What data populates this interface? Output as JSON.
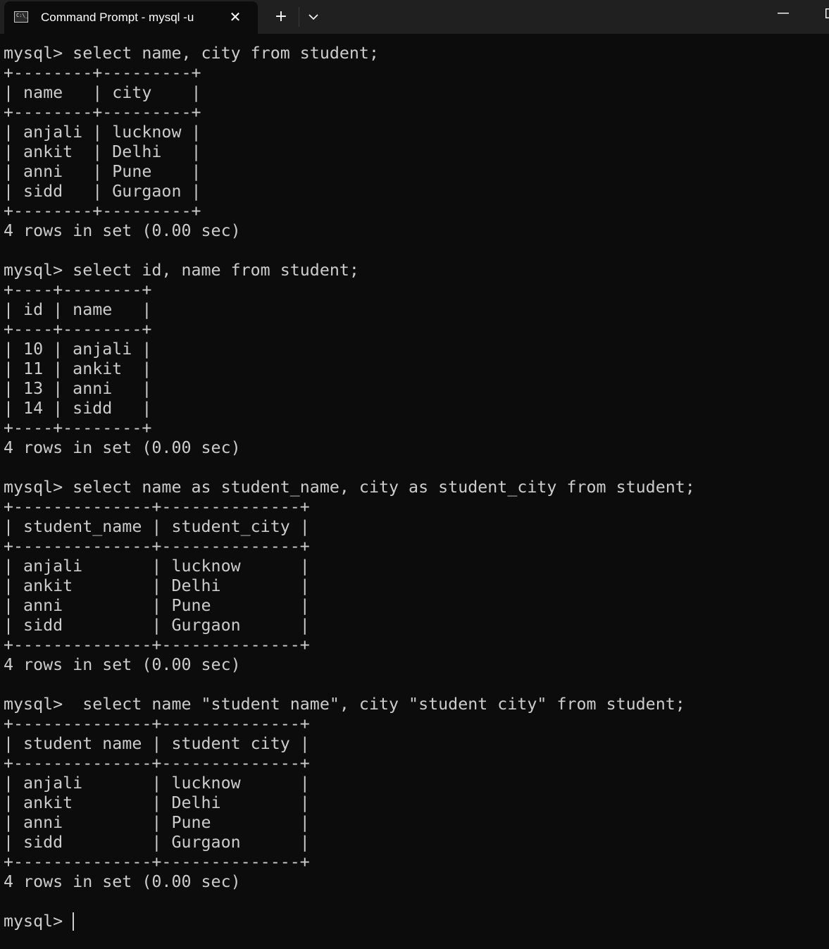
{
  "window": {
    "tab_title": "Command Prompt - mysql  -u",
    "tab_icon_prompt": "C:\\_",
    "close_glyph": "✕",
    "new_tab_glyph": "+"
  },
  "terminal": {
    "lines": [
      "mysql> select name, city from student;",
      "+--------+---------+",
      "| name   | city    |",
      "+--------+---------+",
      "| anjali | lucknow |",
      "| ankit  | Delhi   |",
      "| anni   | Pune    |",
      "| sidd   | Gurgaon |",
      "+--------+---------+",
      "4 rows in set (0.00 sec)",
      "",
      "mysql> select id, name from student;",
      "+----+--------+",
      "| id | name   |",
      "+----+--------+",
      "| 10 | anjali |",
      "| 11 | ankit  |",
      "| 13 | anni   |",
      "| 14 | sidd   |",
      "+----+--------+",
      "4 rows in set (0.00 sec)",
      "",
      "mysql> select name as student_name, city as student_city from student;",
      "+--------------+--------------+",
      "| student_name | student_city |",
      "+--------------+--------------+",
      "| anjali       | lucknow      |",
      "| ankit        | Delhi        |",
      "| anni         | Pune         |",
      "| sidd         | Gurgaon      |",
      "+--------------+--------------+",
      "4 rows in set (0.00 sec)",
      "",
      "mysql>  select name \"student name\", city \"student city\" from student;",
      "+--------------+--------------+",
      "| student name | student city |",
      "+--------------+--------------+",
      "| anjali       | lucknow      |",
      "| ankit        | Delhi        |",
      "| anni         | Pune         |",
      "| sidd         | Gurgaon      |",
      "+--------------+--------------+",
      "4 rows in set (0.00 sec)",
      ""
    ],
    "prompt": "mysql> "
  }
}
